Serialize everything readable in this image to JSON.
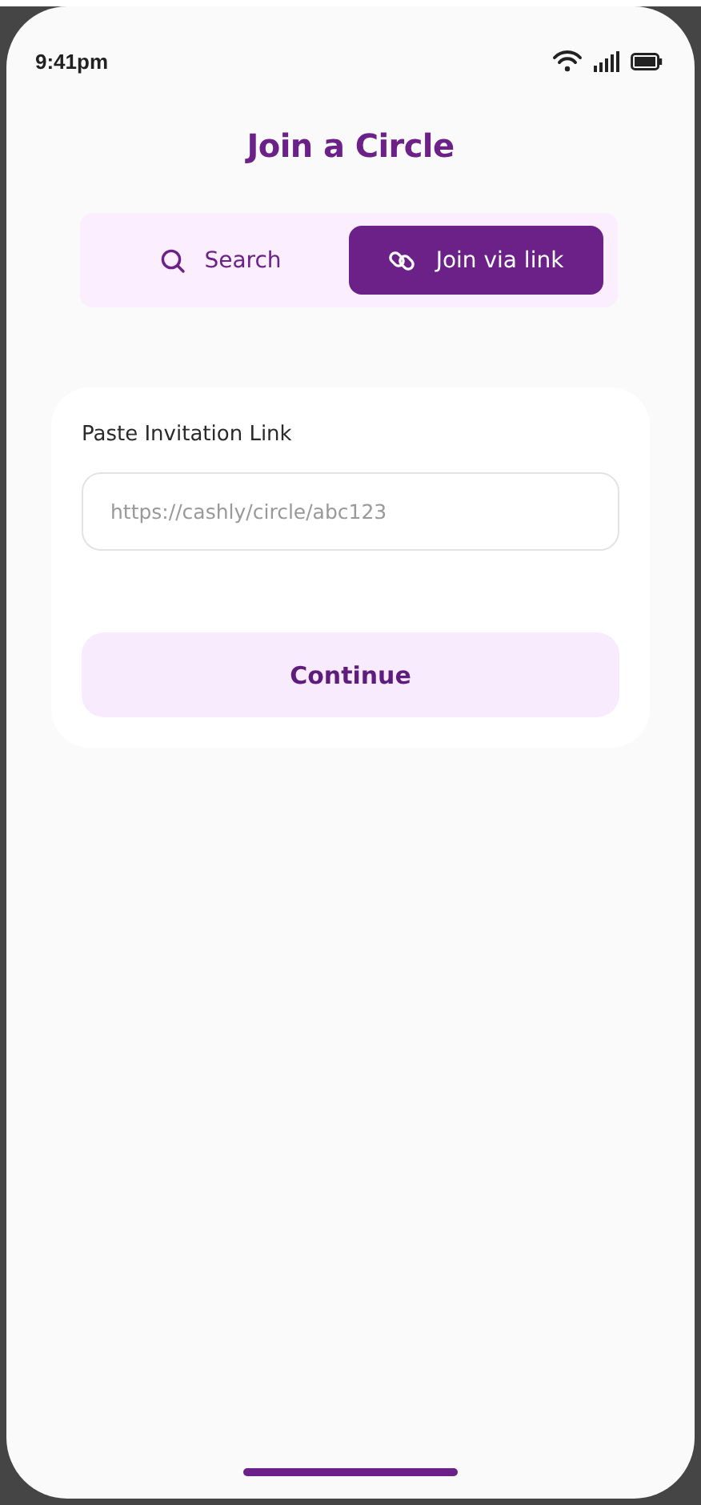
{
  "status_bar": {
    "time": "9:41pm"
  },
  "title": "Join a Circle",
  "tabs": [
    {
      "label": "Search",
      "kind": "search",
      "selected": false
    },
    {
      "label": "Join via link",
      "kind": "link",
      "selected": true
    }
  ],
  "form": {
    "label": "Paste Invitation Link",
    "field": {
      "placeholder": "https://cashly/circle/abc123"
    },
    "button": "Continue"
  }
}
